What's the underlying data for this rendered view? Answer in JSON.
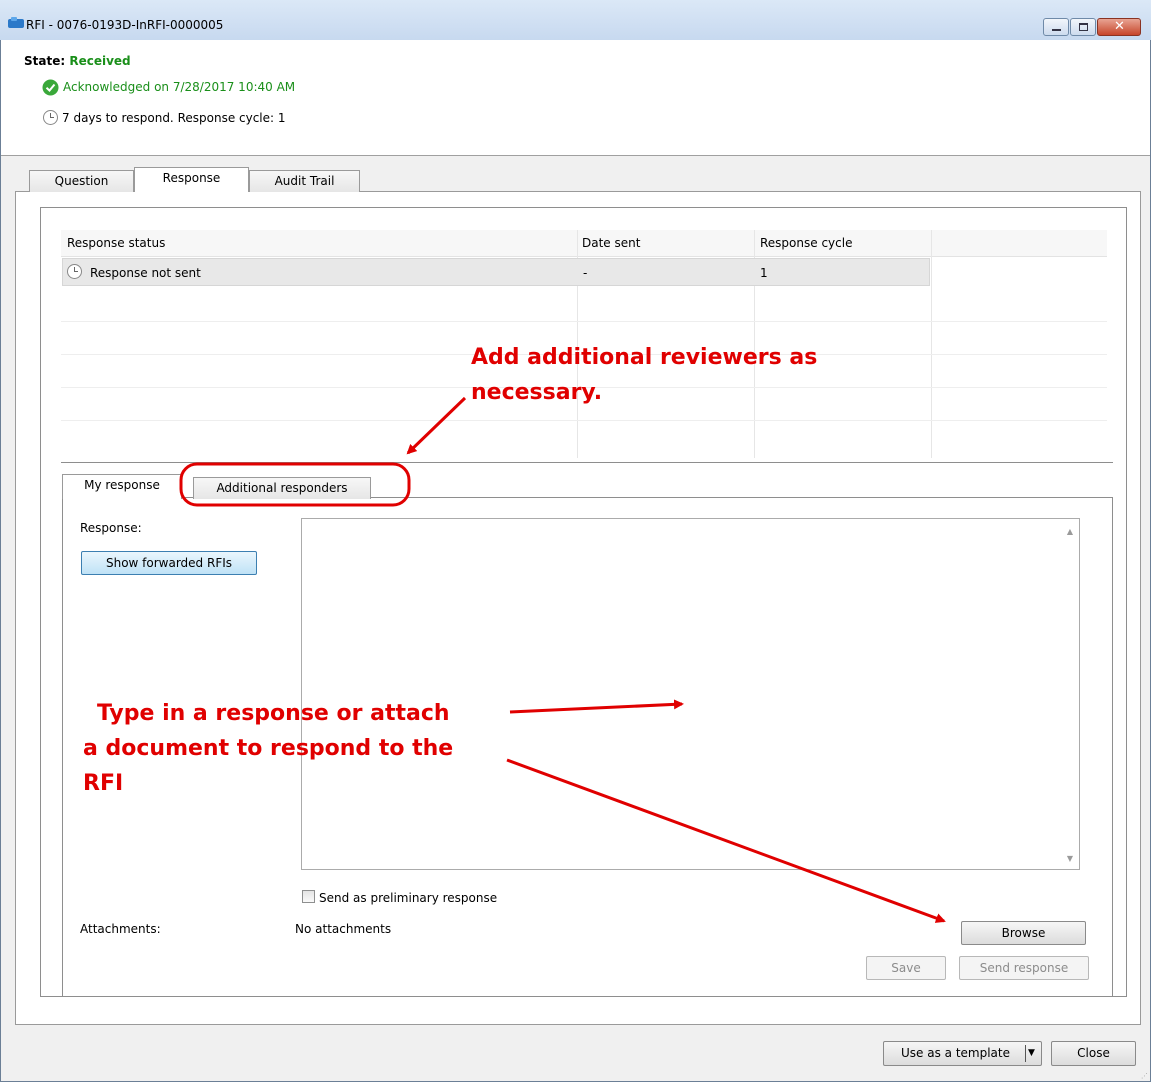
{
  "window": {
    "title": "RFI - 0076-0193D-InRFI-0000005",
    "controls": [
      "minimize-icon",
      "maximize-icon",
      "close-icon"
    ]
  },
  "header": {
    "state_label": "State:",
    "state_value": "Received",
    "acknowledged": "Acknowledged on 7/28/2017 10:40 AM",
    "days_to_respond": "7 days to respond. Response cycle: 1"
  },
  "tabs": [
    {
      "label": "Question",
      "active": false
    },
    {
      "label": "Response",
      "active": true
    },
    {
      "label": "Audit Trail",
      "active": false
    }
  ],
  "grid": {
    "columns": [
      "Response status",
      "Date sent",
      "Response cycle"
    ],
    "rows": [
      {
        "status": "Response not sent",
        "date_sent": "-",
        "cycle": "1"
      }
    ]
  },
  "subtabs": [
    {
      "label": "My response",
      "active": true
    },
    {
      "label": "Additional responders",
      "active": false
    }
  ],
  "form": {
    "response_label": "Response:",
    "show_forwarded_button": "Show forwarded RFIs",
    "response_text": "",
    "preliminary_checkbox_label": "Send as preliminary response",
    "preliminary_checked": false,
    "attachments_label": "Attachments:",
    "attachments_value": "No attachments",
    "browse_button": "Browse",
    "save_button": "Save",
    "send_button": "Send response"
  },
  "footer": {
    "template_button": "Use as a template",
    "close_button": "Close"
  },
  "annotations": {
    "reviewers_line1": "Add additional reviewers as",
    "reviewers_line2": "necessary.",
    "type_line1": "Type in a response or attach",
    "type_line2": "a document to respond to the",
    "type_line3": "RFI",
    "color": "#e00000"
  }
}
